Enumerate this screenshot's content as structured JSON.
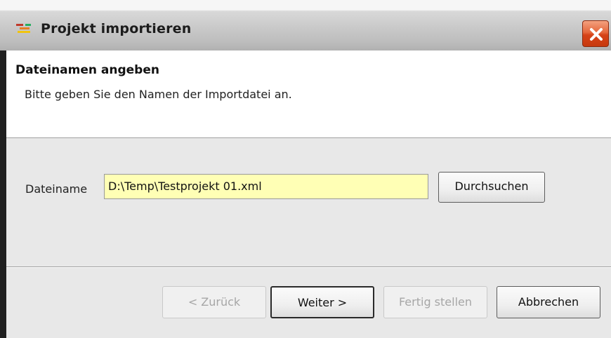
{
  "window": {
    "title": "Projekt importieren",
    "app_icon": "import-project-icon",
    "close_icon": "close-icon"
  },
  "header": {
    "heading": "Dateinamen angeben",
    "subtext": "Bitte geben Sie den Namen der Importdatei an."
  },
  "form": {
    "filename_label": "Dateiname",
    "filename_value": "D:\\Temp\\Testprojekt 01.xml",
    "browse_label": "Durchsuchen"
  },
  "footer": {
    "back_label": "< Zurück",
    "next_label": "Weiter >",
    "finish_label": "Fertig stellen",
    "cancel_label": "Abbrechen"
  },
  "colors": {
    "input_background": "#ffffb5",
    "close_button": "#d64318",
    "dialog_background": "#e8e8e8"
  }
}
